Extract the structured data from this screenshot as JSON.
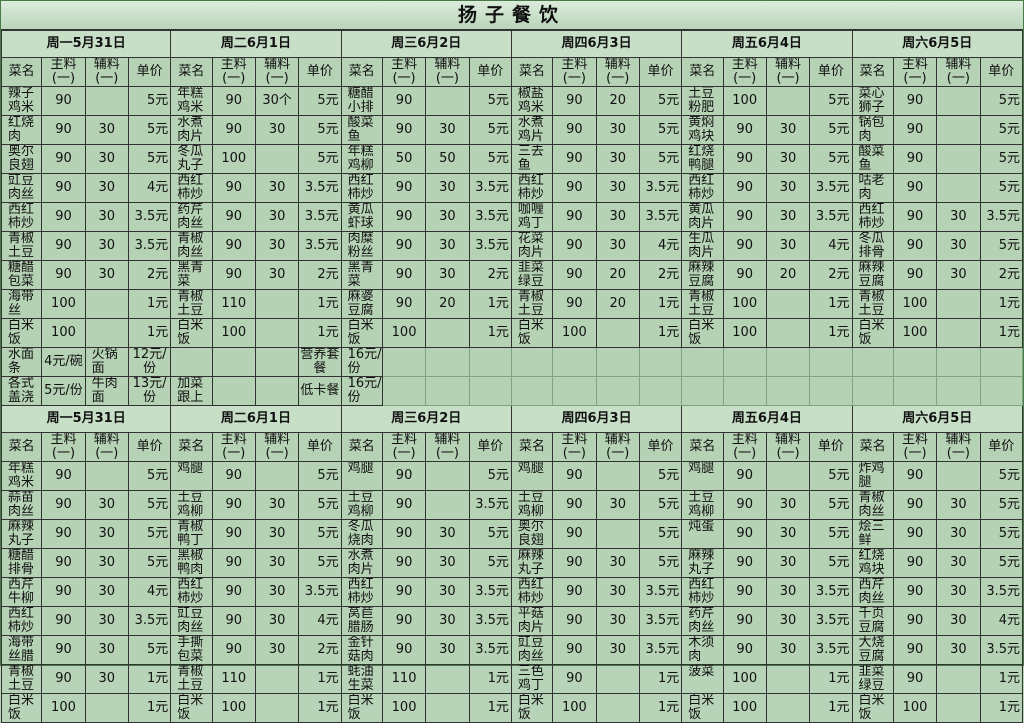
{
  "title": "扬子餐饮",
  "section1": {
    "days": [
      "周一5月31日",
      "周二6月1日",
      "周三6月2日",
      "周四6月3日",
      "周五6月4日",
      "周六6月5日"
    ],
    "headers": [
      "菜名",
      "主料(一)",
      "辅料(一)",
      "单价"
    ],
    "rows": [
      [
        [
          "辣子鸡米",
          "90",
          "",
          "5元"
        ],
        [
          "年糕鸡米",
          "90",
          "30个",
          "5元"
        ],
        [
          "糖醋小排",
          "90",
          "",
          "5元"
        ],
        [
          "椒盐鸡米",
          "90",
          "20",
          "5元"
        ],
        [
          "土豆粉肥",
          "100",
          "",
          "5元"
        ],
        [
          "菜心狮子",
          "90",
          "",
          "5元"
        ]
      ],
      [
        [
          "红烧肉",
          "90",
          "30",
          "5元"
        ],
        [
          "水煮肉片",
          "90",
          "30",
          "5元"
        ],
        [
          "酸菜鱼",
          "90",
          "30",
          "5元"
        ],
        [
          "水煮鸡片",
          "90",
          "30",
          "5元"
        ],
        [
          "黄焖鸡块",
          "90",
          "30",
          "5元"
        ],
        [
          "锅包肉",
          "90",
          "",
          "5元"
        ]
      ],
      [
        [
          "奥尔良翅",
          "90",
          "30",
          "5元"
        ],
        [
          "冬瓜丸子",
          "100",
          "",
          "5元"
        ],
        [
          "年糕鸡柳",
          "50",
          "50",
          "5元"
        ],
        [
          "三去鱼",
          "90",
          "30",
          "5元"
        ],
        [
          "红烧鸭腿",
          "90",
          "30",
          "5元"
        ],
        [
          "酸菜鱼",
          "90",
          "",
          "5元"
        ]
      ],
      [
        [
          "豇豆肉丝",
          "90",
          "30",
          "4元"
        ],
        [
          "西红柿炒",
          "90",
          "30",
          "3.5元"
        ],
        [
          "西红柿炒",
          "90",
          "30",
          "3.5元"
        ],
        [
          "西红柿炒",
          "90",
          "30",
          "3.5元"
        ],
        [
          "西红柿炒",
          "90",
          "30",
          "3.5元"
        ],
        [
          "咕老肉",
          "90",
          "",
          "5元"
        ]
      ],
      [
        [
          "西红柿炒",
          "90",
          "30",
          "3.5元"
        ],
        [
          "药芹肉丝",
          "90",
          "30",
          "3.5元"
        ],
        [
          "黄瓜虾球",
          "90",
          "30",
          "3.5元"
        ],
        [
          "咖喱鸡丁",
          "90",
          "30",
          "3.5元"
        ],
        [
          "黄瓜肉片",
          "90",
          "30",
          "3.5元"
        ],
        [
          "西红柿炒",
          "90",
          "30",
          "3.5元"
        ]
      ],
      [
        [
          "青椒土豆",
          "90",
          "30",
          "3.5元"
        ],
        [
          "青椒肉丝",
          "90",
          "30",
          "3.5元"
        ],
        [
          "肉糜粉丝",
          "90",
          "30",
          "3.5元"
        ],
        [
          "花菜肉片",
          "90",
          "30",
          "4元"
        ],
        [
          "生瓜肉片",
          "90",
          "30",
          "4元"
        ],
        [
          "冬瓜排骨",
          "90",
          "30",
          "5元"
        ]
      ],
      [
        [
          "糖醋包菜",
          "90",
          "30",
          "2元"
        ],
        [
          "黑青菜",
          "90",
          "30",
          "2元"
        ],
        [
          "黑青菜",
          "90",
          "30",
          "2元"
        ],
        [
          "韭菜绿豆",
          "90",
          "20",
          "2元"
        ],
        [
          "麻辣豆腐",
          "90",
          "20",
          "2元"
        ],
        [
          "麻辣豆腐",
          "90",
          "30",
          "2元"
        ]
      ],
      [
        [
          "海带丝",
          "100",
          "",
          "1元"
        ],
        [
          "青椒土豆",
          "110",
          "",
          "1元"
        ],
        [
          "麻婆豆腐",
          "90",
          "20",
          "1元"
        ],
        [
          "青椒土豆",
          "90",
          "20",
          "1元"
        ],
        [
          "青椒土豆",
          "100",
          "",
          "1元"
        ],
        [
          "青椒土豆",
          "100",
          "",
          "1元"
        ]
      ],
      [
        [
          "白米饭",
          "100",
          "",
          "1元"
        ],
        [
          "白米饭",
          "100",
          "",
          "1元"
        ],
        [
          "白米饭",
          "100",
          "",
          "1元"
        ],
        [
          "白米饭",
          "100",
          "",
          "1元"
        ],
        [
          "白米饭",
          "100",
          "",
          "1元"
        ],
        [
          "白米饭",
          "100",
          "",
          "1元"
        ]
      ]
    ],
    "extras": [
      [
        "水面条",
        "4元/碗",
        "火锅面",
        "12元/份",
        "",
        "",
        "",
        "营养套餐",
        "16元/份"
      ],
      [
        "各式盖浇",
        "5元/份",
        "牛肉面",
        "13元/份",
        "加菜跟上",
        "",
        "",
        "低卡餐",
        "16元/份"
      ]
    ]
  },
  "section2": {
    "days": [
      "周一5月31日",
      "周二6月1日",
      "周三6月2日",
      "周四6月3日",
      "周五6月4日",
      "周六6月5日"
    ],
    "headers": [
      "菜名",
      "主料(一)",
      "辅料(一)",
      "单价"
    ],
    "rows": [
      [
        [
          "年糕鸡米",
          "90",
          "",
          "5元"
        ],
        [
          "鸡腿",
          "90",
          "",
          "5元"
        ],
        [
          "鸡腿",
          "90",
          "",
          "5元"
        ],
        [
          "鸡腿",
          "90",
          "",
          "5元"
        ],
        [
          "鸡腿",
          "90",
          "",
          "5元"
        ],
        [
          "炸鸡腿",
          "90",
          "",
          "5元"
        ]
      ],
      [
        [
          "蒜苗肉丝",
          "90",
          "30",
          "5元"
        ],
        [
          "土豆鸡柳",
          "90",
          "30",
          "5元"
        ],
        [
          "土豆鸡柳",
          "90",
          "",
          "3.5元"
        ],
        [
          "土豆鸡柳",
          "90",
          "30",
          "5元"
        ],
        [
          "土豆鸡柳",
          "90",
          "30",
          "5元"
        ],
        [
          "青椒肉丝",
          "90",
          "30",
          "5元"
        ]
      ],
      [
        [
          "麻辣丸子",
          "90",
          "30",
          "5元"
        ],
        [
          "青椒鸭丁",
          "90",
          "30",
          "5元"
        ],
        [
          "冬瓜烧肉",
          "90",
          "30",
          "5元"
        ],
        [
          "奥尔良翅",
          "90",
          "",
          "5元"
        ],
        [
          "炖蛋",
          "90",
          "30",
          "5元"
        ],
        [
          "烩三鲜",
          "90",
          "30",
          "5元"
        ]
      ],
      [
        [
          "糖醋排骨",
          "90",
          "30",
          "5元"
        ],
        [
          "黑椒鸭肉",
          "90",
          "30",
          "5元"
        ],
        [
          "水煮肉片",
          "90",
          "30",
          "5元"
        ],
        [
          "麻辣丸子",
          "90",
          "30",
          "5元"
        ],
        [
          "麻辣丸子",
          "90",
          "30",
          "5元"
        ],
        [
          "红烧鸡块",
          "90",
          "30",
          "5元"
        ]
      ],
      [
        [
          "西芹牛柳",
          "90",
          "30",
          "4元"
        ],
        [
          "西红柿炒",
          "90",
          "30",
          "3.5元"
        ],
        [
          "西红柿炒",
          "90",
          "30",
          "3.5元"
        ],
        [
          "西红柿炒",
          "90",
          "30",
          "3.5元"
        ],
        [
          "西红柿炒",
          "90",
          "30",
          "3.5元"
        ],
        [
          "西芹肉丝",
          "90",
          "30",
          "3.5元"
        ]
      ],
      [
        [
          "西红柿炒",
          "90",
          "30",
          "3.5元"
        ],
        [
          "豇豆肉丝",
          "90",
          "30",
          "4元"
        ],
        [
          "莴苣腊肠",
          "90",
          "30",
          "3.5元"
        ],
        [
          "平菇肉片",
          "90",
          "30",
          "3.5元"
        ],
        [
          "药芹肉丝",
          "90",
          "30",
          "3.5元"
        ],
        [
          "千页豆腐",
          "90",
          "30",
          "4元"
        ]
      ],
      [
        [
          "海带丝腊",
          "90",
          "30",
          "5元"
        ],
        [
          "手撕包菜",
          "90",
          "30",
          "2元"
        ],
        [
          "金针菇肉",
          "90",
          "30",
          "3.5元"
        ],
        [
          "豇豆肉丝",
          "90",
          "30",
          "3.5元"
        ],
        [
          "木须肉",
          "90",
          "30",
          "3.5元"
        ],
        [
          "大烧豆腐",
          "90",
          "30",
          "3.5元"
        ]
      ],
      [
        [
          "青椒土豆",
          "90",
          "30",
          "1元"
        ],
        [
          "青椒土豆",
          "110",
          "",
          "1元"
        ],
        [
          "蚝油生菜",
          "110",
          "",
          "1元"
        ],
        [
          "三色鸡丁",
          "90",
          "",
          "1元"
        ],
        [
          "菠菜",
          "100",
          "",
          "1元"
        ],
        [
          "韭菜绿豆",
          "90",
          "",
          "1元"
        ]
      ],
      [
        [
          "白米饭",
          "100",
          "",
          "1元"
        ],
        [
          "白米饭",
          "100",
          "",
          "1元"
        ],
        [
          "白米饭",
          "100",
          "",
          "1元"
        ],
        [
          "白米饭",
          "100",
          "",
          "1元"
        ],
        [
          "白米饭",
          "100",
          "",
          "1元"
        ],
        [
          "白米饭",
          "100",
          "",
          "1元"
        ]
      ]
    ]
  }
}
